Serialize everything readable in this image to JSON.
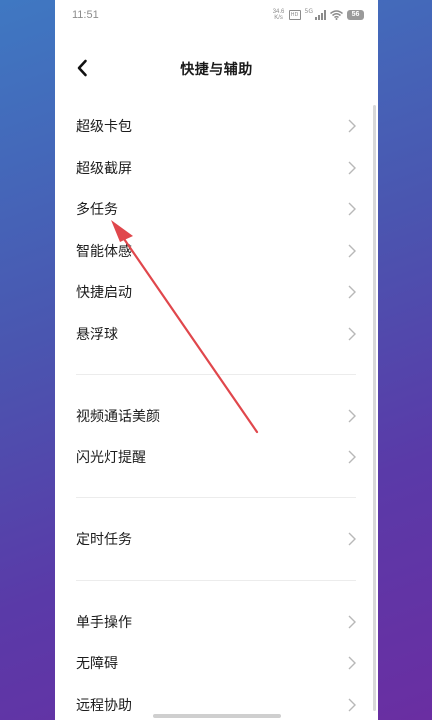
{
  "status_bar": {
    "time": "11:51",
    "net_speed_value": "34.6",
    "net_speed_unit": "K/s",
    "hd_label": "HD",
    "network_label": "5G",
    "battery_level": "56"
  },
  "header": {
    "title": "快捷与辅助",
    "back_icon": "chevron-left-icon"
  },
  "groups": [
    {
      "items": [
        {
          "label": "超级卡包"
        },
        {
          "label": "超级截屏"
        },
        {
          "label": "多任务"
        },
        {
          "label": "智能体感"
        },
        {
          "label": "快捷启动"
        },
        {
          "label": "悬浮球"
        }
      ]
    },
    {
      "items": [
        {
          "label": "视频通话美颜"
        },
        {
          "label": "闪光灯提醒"
        }
      ]
    },
    {
      "items": [
        {
          "label": "定时任务"
        }
      ]
    },
    {
      "items": [
        {
          "label": "单手操作"
        },
        {
          "label": "无障碍"
        },
        {
          "label": "远程协助"
        }
      ]
    }
  ],
  "colors": {
    "annotation_arrow": "#e0474c",
    "background_gradient_start": "#3f78c2",
    "background_gradient_end": "#6a2ea2"
  }
}
